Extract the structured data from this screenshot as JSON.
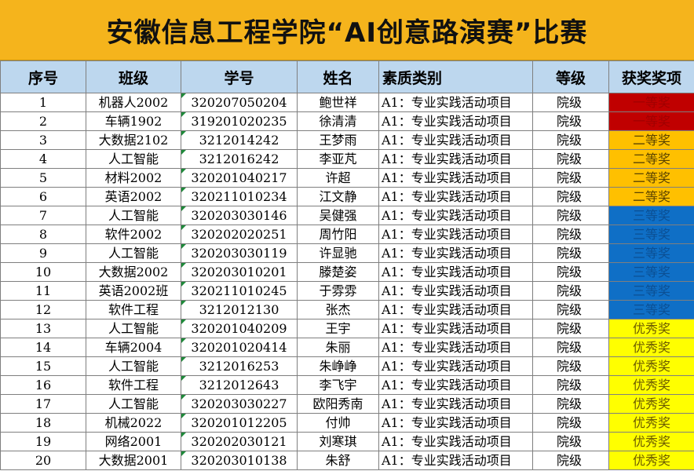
{
  "title": "安徽信息工程学院“AI创意路演赛”比赛",
  "columns": [
    "序号",
    "班级",
    "学号",
    "姓名",
    "素质类别",
    "等级",
    "获奖奖项"
  ],
  "colors": {
    "header_bg": "#bdd7ee",
    "title_bg": "#f5b41c",
    "first_prize": "#c00000",
    "second_prize": "#ffc000",
    "third_prize": "#0f6fc6",
    "excellence": "#ffff00"
  },
  "rows": [
    {
      "no": "1",
      "class": "机器人2002",
      "id": "320207050204",
      "name": "鲍世祥",
      "category": "A1：专业实践活动项目",
      "level": "院级",
      "award": "一等奖",
      "award_rank": 1
    },
    {
      "no": "2",
      "class": "车辆1902",
      "id": "319201020235",
      "name": "徐清清",
      "category": "A1：专业实践活动项目",
      "level": "院级",
      "award": "一等奖",
      "award_rank": 1
    },
    {
      "no": "3",
      "class": "大数据2102",
      "id": "3212014242",
      "name": "王梦雨",
      "category": "A1：专业实践活动项目",
      "level": "院级",
      "award": "二等奖",
      "award_rank": 2
    },
    {
      "no": "4",
      "class": "人工智能",
      "id": "3212016242",
      "name": "李亚芃",
      "category": "A1：专业实践活动项目",
      "level": "院级",
      "award": "二等奖",
      "award_rank": 2
    },
    {
      "no": "5",
      "class": "材料2002",
      "id": "320201040217",
      "name": "许超",
      "category": "A1：专业实践活动项目",
      "level": "院级",
      "award": "二等奖",
      "award_rank": 2
    },
    {
      "no": "6",
      "class": "英语2002",
      "id": "320211010234",
      "name": "江文静",
      "category": "A1：专业实践活动项目",
      "level": "院级",
      "award": "二等奖",
      "award_rank": 2
    },
    {
      "no": "7",
      "class": "人工智能",
      "id": "320203030146",
      "name": "吴健强",
      "category": "A1：专业实践活动项目",
      "level": "院级",
      "award": "三等奖",
      "award_rank": 3
    },
    {
      "no": "8",
      "class": "软件2002",
      "id": "320202020251",
      "name": "周竹阳",
      "category": "A1：专业实践活动项目",
      "level": "院级",
      "award": "三等奖",
      "award_rank": 3
    },
    {
      "no": "9",
      "class": "人工智能",
      "id": "320203030119",
      "name": "许显驰",
      "category": "A1：专业实践活动项目",
      "level": "院级",
      "award": "三等奖",
      "award_rank": 3
    },
    {
      "no": "10",
      "class": "大数据2002",
      "id": "320203010201",
      "name": "滕楚姿",
      "category": "A1：专业实践活动项目",
      "level": "院级",
      "award": "三等奖",
      "award_rank": 3
    },
    {
      "no": "11",
      "class": "英语2002班",
      "id": "320211010245",
      "name": "于雰雰",
      "category": "A1：专业实践活动项目",
      "level": "院级",
      "award": "三等奖",
      "award_rank": 3
    },
    {
      "no": "12",
      "class": "软件工程",
      "id": "3212012130",
      "name": "张杰",
      "category": "A1：专业实践活动项目",
      "level": "院级",
      "award": "三等奖",
      "award_rank": 3
    },
    {
      "no": "13",
      "class": "人工智能",
      "id": "320201040209",
      "name": "王宇",
      "category": "A1：专业实践活动项目",
      "level": "院级",
      "award": "优秀奖",
      "award_rank": 4
    },
    {
      "no": "14",
      "class": "车辆2004",
      "id": "320201020414",
      "name": "朱丽",
      "category": "A1：专业实践活动项目",
      "level": "院级",
      "award": "优秀奖",
      "award_rank": 4
    },
    {
      "no": "15",
      "class": "人工智能",
      "id": "3212016253",
      "name": "朱峥峥",
      "category": "A1：专业实践活动项目",
      "level": "院级",
      "award": "优秀奖",
      "award_rank": 4
    },
    {
      "no": "16",
      "class": "软件工程",
      "id": "3212012643",
      "name": "李飞宇",
      "category": "A1：专业实践活动项目",
      "level": "院级",
      "award": "优秀奖",
      "award_rank": 4
    },
    {
      "no": "17",
      "class": "人工智能",
      "id": "320203030227",
      "name": "欧阳秀南",
      "category": "A1：专业实践活动项目",
      "level": "院级",
      "award": "优秀奖",
      "award_rank": 4
    },
    {
      "no": "18",
      "class": "机械2022",
      "id": "320201012205",
      "name": "付帅",
      "category": "A1：专业实践活动项目",
      "level": "院级",
      "award": "优秀奖",
      "award_rank": 4
    },
    {
      "no": "19",
      "class": "网络2001",
      "id": "320202030121",
      "name": "刘寒琪",
      "category": "A1：专业实践活动项目",
      "level": "院级",
      "award": "优秀奖",
      "award_rank": 4
    },
    {
      "no": "20",
      "class": "大数据2001",
      "id": "320203010138",
      "name": "朱舒",
      "category": "A1：专业实践活动项目",
      "level": "院级",
      "award": "优秀奖",
      "award_rank": 4
    }
  ]
}
